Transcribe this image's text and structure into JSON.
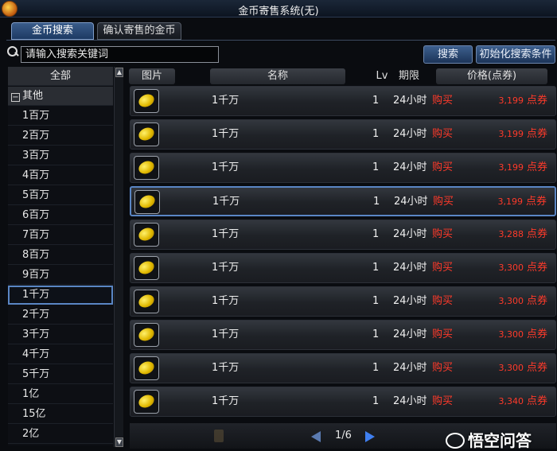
{
  "window": {
    "title": "金币寄售系统(无)"
  },
  "tabs": {
    "search": "金币搜索",
    "confirm": "确认寄售的金币"
  },
  "search": {
    "placeholder": "请输入搜索关键词",
    "search_label": "搜索",
    "reset_label": "初始化搜索条件"
  },
  "sidebar": {
    "all": "全部",
    "group": "其他",
    "group_toggle": "−",
    "items": [
      "1百万",
      "2百万",
      "3百万",
      "4百万",
      "5百万",
      "6百万",
      "7百万",
      "8百万",
      "9百万",
      "1千万",
      "2千万",
      "3千万",
      "4千万",
      "5千万",
      "1亿",
      "15亿",
      "2亿"
    ],
    "selected_index": 9
  },
  "columns": {
    "image": "图片",
    "name": "名称",
    "lv": "Lv",
    "period": "期限",
    "price": "价格(点券)"
  },
  "rows": [
    {
      "name": "1千万",
      "lv": "1",
      "period": "24小时",
      "buy": "购买",
      "price": "3,199",
      "unit": "点券"
    },
    {
      "name": "1千万",
      "lv": "1",
      "period": "24小时",
      "buy": "购买",
      "price": "3,199",
      "unit": "点券"
    },
    {
      "name": "1千万",
      "lv": "1",
      "period": "24小时",
      "buy": "购买",
      "price": "3,199",
      "unit": "点券"
    },
    {
      "name": "1千万",
      "lv": "1",
      "period": "24小时",
      "buy": "购买",
      "price": "3,199",
      "unit": "点券"
    },
    {
      "name": "1千万",
      "lv": "1",
      "period": "24小时",
      "buy": "购买",
      "price": "3,288",
      "unit": "点券"
    },
    {
      "name": "1千万",
      "lv": "1",
      "period": "24小时",
      "buy": "购买",
      "price": "3,300",
      "unit": "点券"
    },
    {
      "name": "1千万",
      "lv": "1",
      "period": "24小时",
      "buy": "购买",
      "price": "3,300",
      "unit": "点券"
    },
    {
      "name": "1千万",
      "lv": "1",
      "period": "24小时",
      "buy": "购买",
      "price": "3,300",
      "unit": "点券"
    },
    {
      "name": "1千万",
      "lv": "1",
      "period": "24小时",
      "buy": "购买",
      "price": "3,300",
      "unit": "点券"
    },
    {
      "name": "1千万",
      "lv": "1",
      "period": "24小时",
      "buy": "购买",
      "price": "3,340",
      "unit": "点券"
    }
  ],
  "selected_row": 3,
  "pager": {
    "text": "1/6"
  },
  "watermark": "悟空问答",
  "icons": {
    "search": "search-icon",
    "coin": "gold-coin-icon",
    "prev": "arrow-left-icon",
    "next": "arrow-right-icon"
  },
  "colors": {
    "accent": "#5a86c4",
    "price": "#ff3a2a"
  }
}
